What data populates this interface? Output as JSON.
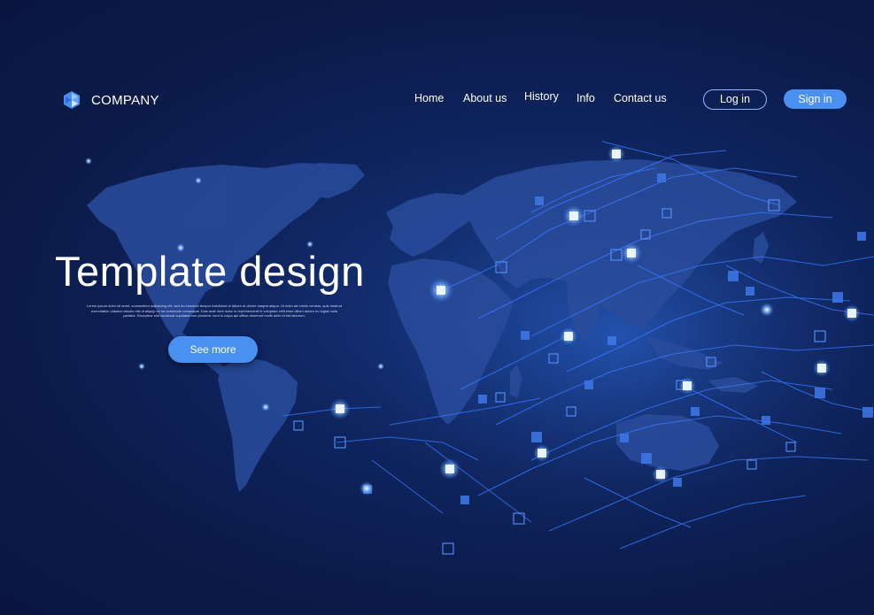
{
  "brand": {
    "name": "COMPANY",
    "icon": "hexagon-logo-icon"
  },
  "nav": {
    "items": [
      {
        "label": "Home"
      },
      {
        "label": "About us"
      },
      {
        "label": "History"
      },
      {
        "label": "Info"
      },
      {
        "label": "Contact us"
      }
    ],
    "login_label": "Log in",
    "signin_label": "Sign in"
  },
  "hero": {
    "title": "Template design",
    "text": "Lorem ipsum dolor sit amet, consectetur adipiscing elit, sed do eiusmod tempor incididunt ut labore et dolore magna aliqua. Ut enim ad minim veniam, quis nostrud exercitation ullamco laboris nisi ut aliquip ex ea commodo consequat. Duis aute irure dolor in reprehenderit in voluptate velit esse cillum dolore eu fugiat nulla pariatur. Excepteur sint occaecat cupidatat non proident, sunt in culpa qui officia deserunt mollit anim id est laborum.",
    "cta_label": "See more"
  },
  "colors": {
    "background": "#0b1a48",
    "accent": "#4a90f0",
    "map": "#2a4fa0",
    "circuit": "#3d7cff",
    "glow": "#bfe0ff"
  }
}
